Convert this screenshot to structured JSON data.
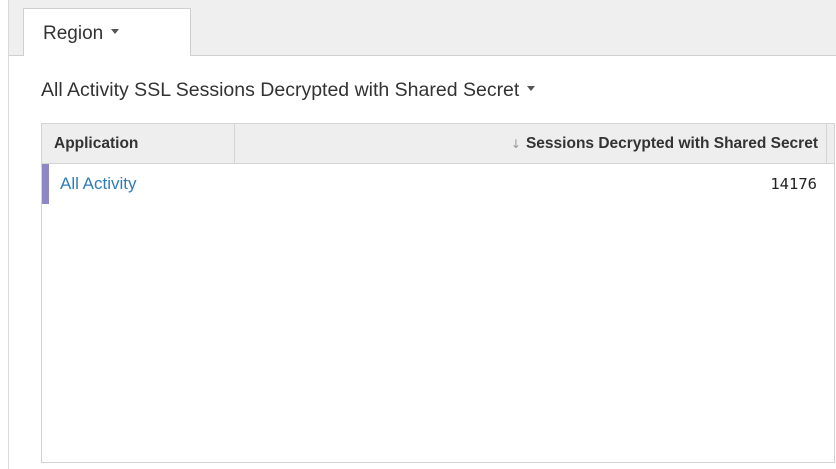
{
  "tabs": [
    {
      "label": "Region"
    }
  ],
  "panel": {
    "title": "All Activity SSL Sessions Decrypted with Shared Secret"
  },
  "table": {
    "columns": [
      {
        "label": "Application"
      },
      {
        "label": "Sessions Decrypted with Shared Secret",
        "sort": "descending"
      }
    ],
    "rows": [
      {
        "application": "All Activity",
        "value": "14176"
      }
    ]
  },
  "colors": {
    "accent": "#8d88c4",
    "link": "#2f7db8",
    "header_bg": "#eeeeee",
    "tabbar_bg": "#efefef"
  },
  "icons": {
    "sort": "sort-down-arrow-icon",
    "dropdown": "caret-down-icon"
  }
}
